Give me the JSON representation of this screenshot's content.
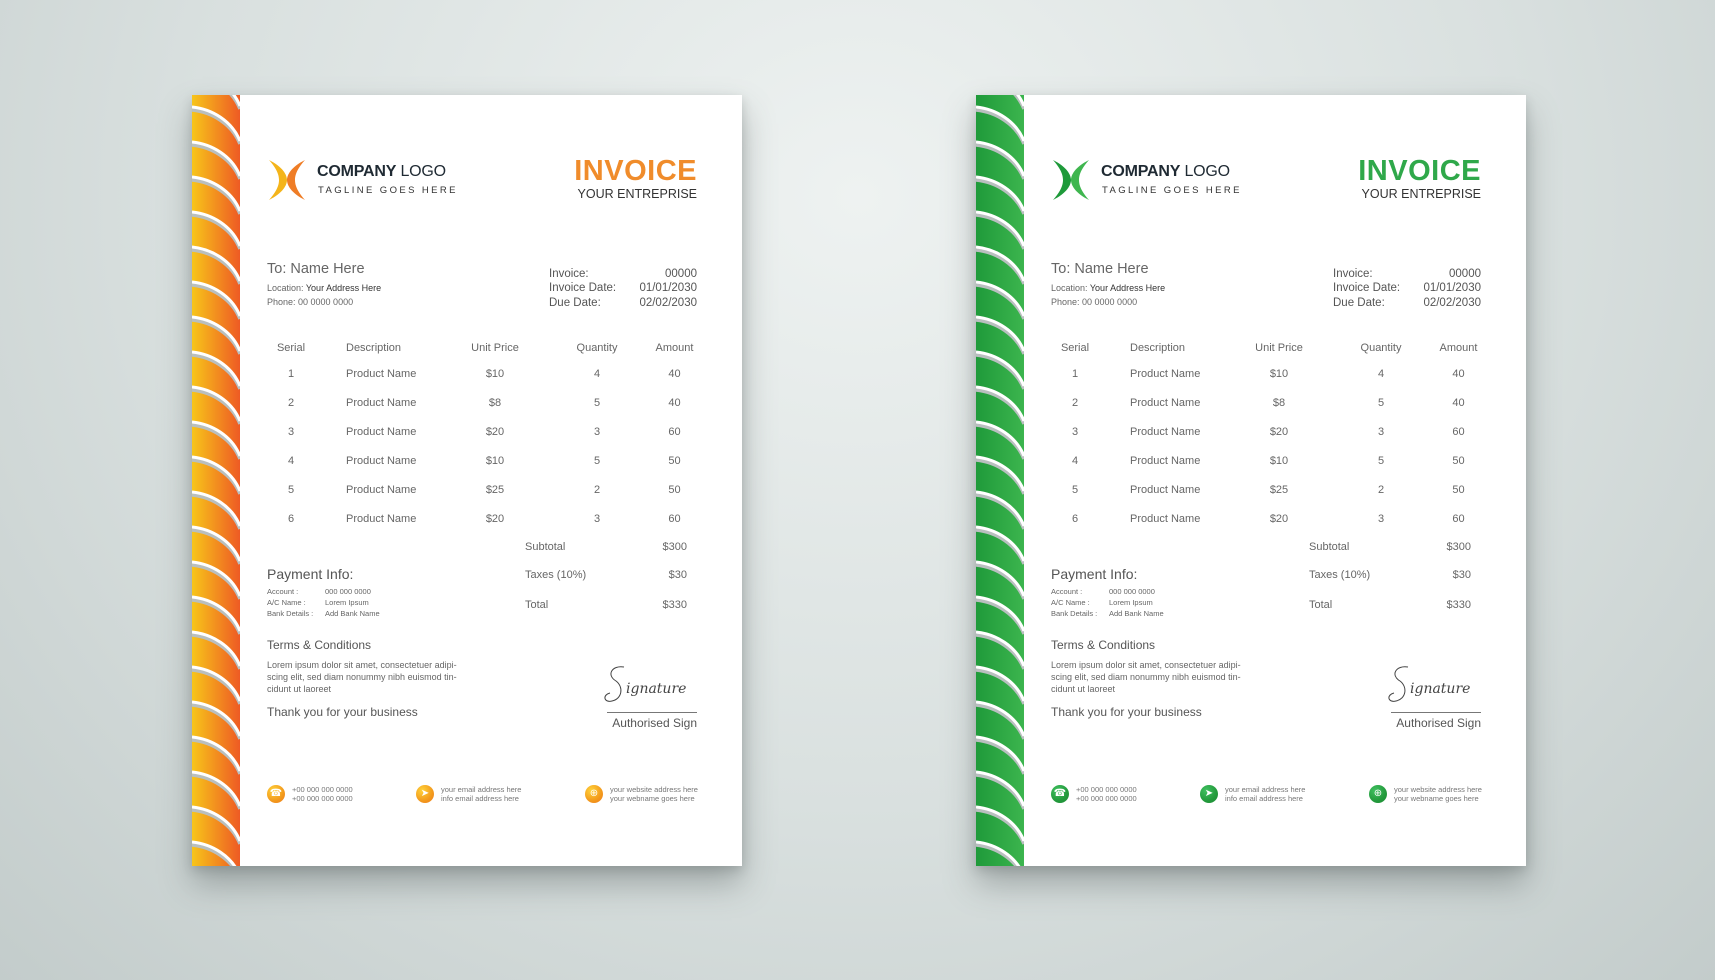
{
  "invoices": [
    {
      "theme": "orange",
      "colors": {
        "accent": "#f08c2b",
        "gradient_start": "#f7c51a",
        "gradient_end": "#ee5a24",
        "logo_left": "#f4b41a",
        "logo_right": "#ef7d26"
      },
      "logo": {
        "name_bold": "COMPANY",
        "name_light": "LOGO",
        "tagline": "TAGLINE GOES HERE"
      },
      "title": "INVOICE",
      "subtitle": "YOUR ENTREPRISE",
      "recipient": {
        "to": "To: Name Here",
        "location_label": "Location:",
        "location_value": "Your Address Here",
        "phone": "Phone: 00 0000 0000"
      },
      "meta": [
        {
          "label": "Invoice:",
          "value": "00000"
        },
        {
          "label": "Invoice Date:",
          "value": "01/01/2030"
        },
        {
          "label": "Due Date:",
          "value": "02/02/2030"
        }
      ],
      "table": {
        "headers": [
          "Serial",
          "Description",
          "Unit Price",
          "Quantity",
          "Amount"
        ],
        "rows": [
          [
            "1",
            "Product Name",
            "$10",
            "4",
            "40"
          ],
          [
            "2",
            "Product Name",
            "$8",
            "5",
            "40"
          ],
          [
            "3",
            "Product Name",
            "$20",
            "3",
            "60"
          ],
          [
            "4",
            "Product Name",
            "$10",
            "5",
            "50"
          ],
          [
            "5",
            "Product Name",
            "$25",
            "2",
            "50"
          ],
          [
            "6",
            "Product Name",
            "$20",
            "3",
            "60"
          ]
        ]
      },
      "totals": [
        {
          "label": "Subtotal",
          "value": "$300"
        },
        {
          "label": "Taxes (10%)",
          "value": "$30"
        },
        {
          "label": "Total",
          "value": "$330"
        }
      ],
      "payment": {
        "title": "Payment Info:",
        "lines": [
          {
            "label": "Account :",
            "value": "000 000 0000"
          },
          {
            "label": "A/C Name :",
            "value": "Lorem Ipsum"
          },
          {
            "label": "Bank Details :",
            "value": "Add Bank Name"
          }
        ]
      },
      "terms": {
        "title": "Terms & Conditions",
        "body": "Lorem ipsum dolor sit amet, consectetuer adipi-scing elit, sed diam nonummy nibh euismod tin-cidunt ut laoreet"
      },
      "thanks": "Thank you for your business",
      "signature": {
        "script": "Signature",
        "label": "Authorised Sign"
      },
      "contacts": [
        {
          "icon": "phone-icon",
          "glyph": "☎",
          "line1": "+00 000 000 0000",
          "line2": "+00 000 000 0000"
        },
        {
          "icon": "send-icon",
          "glyph": "➤",
          "line1": "your email address here",
          "line2": "info email address here"
        },
        {
          "icon": "globe-icon",
          "glyph": "⊕",
          "line1": "your website address here",
          "line2": "your webname goes here"
        }
      ]
    },
    {
      "theme": "green",
      "colors": {
        "accent": "#2fa84a",
        "gradient_start": "#1f9a3a",
        "gradient_end": "#3cb54e",
        "logo_left": "#1e9a3a",
        "logo_right": "#3fb64f"
      },
      "logo": {
        "name_bold": "COMPANY",
        "name_light": "LOGO",
        "tagline": "TAGLINE GOES HERE"
      },
      "title": "INVOICE",
      "subtitle": "YOUR ENTREPRISE",
      "recipient": {
        "to": "To: Name Here",
        "location_label": "Location:",
        "location_value": "Your Address Here",
        "phone": "Phone: 00 0000 0000"
      },
      "meta": [
        {
          "label": "Invoice:",
          "value": "00000"
        },
        {
          "label": "Invoice Date:",
          "value": "01/01/2030"
        },
        {
          "label": "Due Date:",
          "value": "02/02/2030"
        }
      ],
      "table": {
        "headers": [
          "Serial",
          "Description",
          "Unit Price",
          "Quantity",
          "Amount"
        ],
        "rows": [
          [
            "1",
            "Product Name",
            "$10",
            "4",
            "40"
          ],
          [
            "2",
            "Product Name",
            "$8",
            "5",
            "40"
          ],
          [
            "3",
            "Product Name",
            "$20",
            "3",
            "60"
          ],
          [
            "4",
            "Product Name",
            "$10",
            "5",
            "50"
          ],
          [
            "5",
            "Product Name",
            "$25",
            "2",
            "50"
          ],
          [
            "6",
            "Product Name",
            "$20",
            "3",
            "60"
          ]
        ]
      },
      "totals": [
        {
          "label": "Subtotal",
          "value": "$300"
        },
        {
          "label": "Taxes (10%)",
          "value": "$30"
        },
        {
          "label": "Total",
          "value": "$330"
        }
      ],
      "payment": {
        "title": "Payment Info:",
        "lines": [
          {
            "label": "Account :",
            "value": "000 000 0000"
          },
          {
            "label": "A/C Name :",
            "value": "Lorem Ipsum"
          },
          {
            "label": "Bank Details :",
            "value": "Add Bank Name"
          }
        ]
      },
      "terms": {
        "title": "Terms & Conditions",
        "body": "Lorem ipsum dolor sit amet, consectetuer adipi-scing elit, sed diam nonummy nibh euismod tin-cidunt ut laoreet"
      },
      "thanks": "Thank you for your business",
      "signature": {
        "script": "Signature",
        "label": "Authorised Sign"
      },
      "contacts": [
        {
          "icon": "phone-icon",
          "glyph": "☎",
          "line1": "+00 000 000 0000",
          "line2": "+00 000 000 0000"
        },
        {
          "icon": "send-icon",
          "glyph": "➤",
          "line1": "your email address here",
          "line2": "info email address here"
        },
        {
          "icon": "globe-icon",
          "glyph": "⊕",
          "line1": "your website address here",
          "line2": "your webname goes here"
        }
      ]
    }
  ]
}
